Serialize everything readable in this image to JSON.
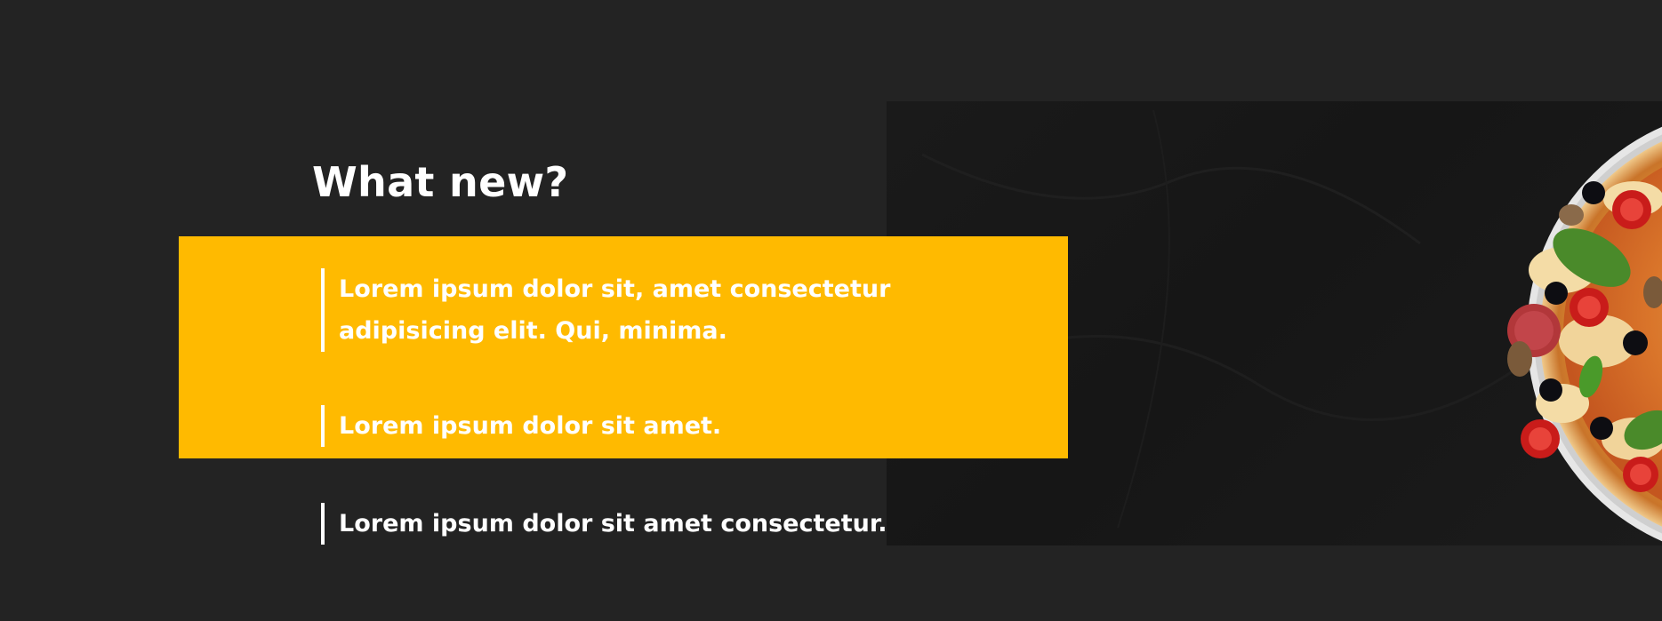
{
  "section": {
    "title": "What new?"
  },
  "news": {
    "items": [
      {
        "lines": [
          "Lorem ipsum dolor sit, amet consectetur",
          "adipisicing elit. Qui, minima."
        ]
      },
      {
        "lines": [
          "Lorem ipsum dolor sit amet."
        ]
      },
      {
        "lines": [
          "Lorem ipsum dolor sit amet consectetur."
        ]
      }
    ]
  },
  "colors": {
    "background": "#232323",
    "accent": "#ffba00",
    "text": "#ffffff",
    "photo_panel": "#1a1a1a"
  },
  "image": {
    "icon": "pizza-photo"
  }
}
